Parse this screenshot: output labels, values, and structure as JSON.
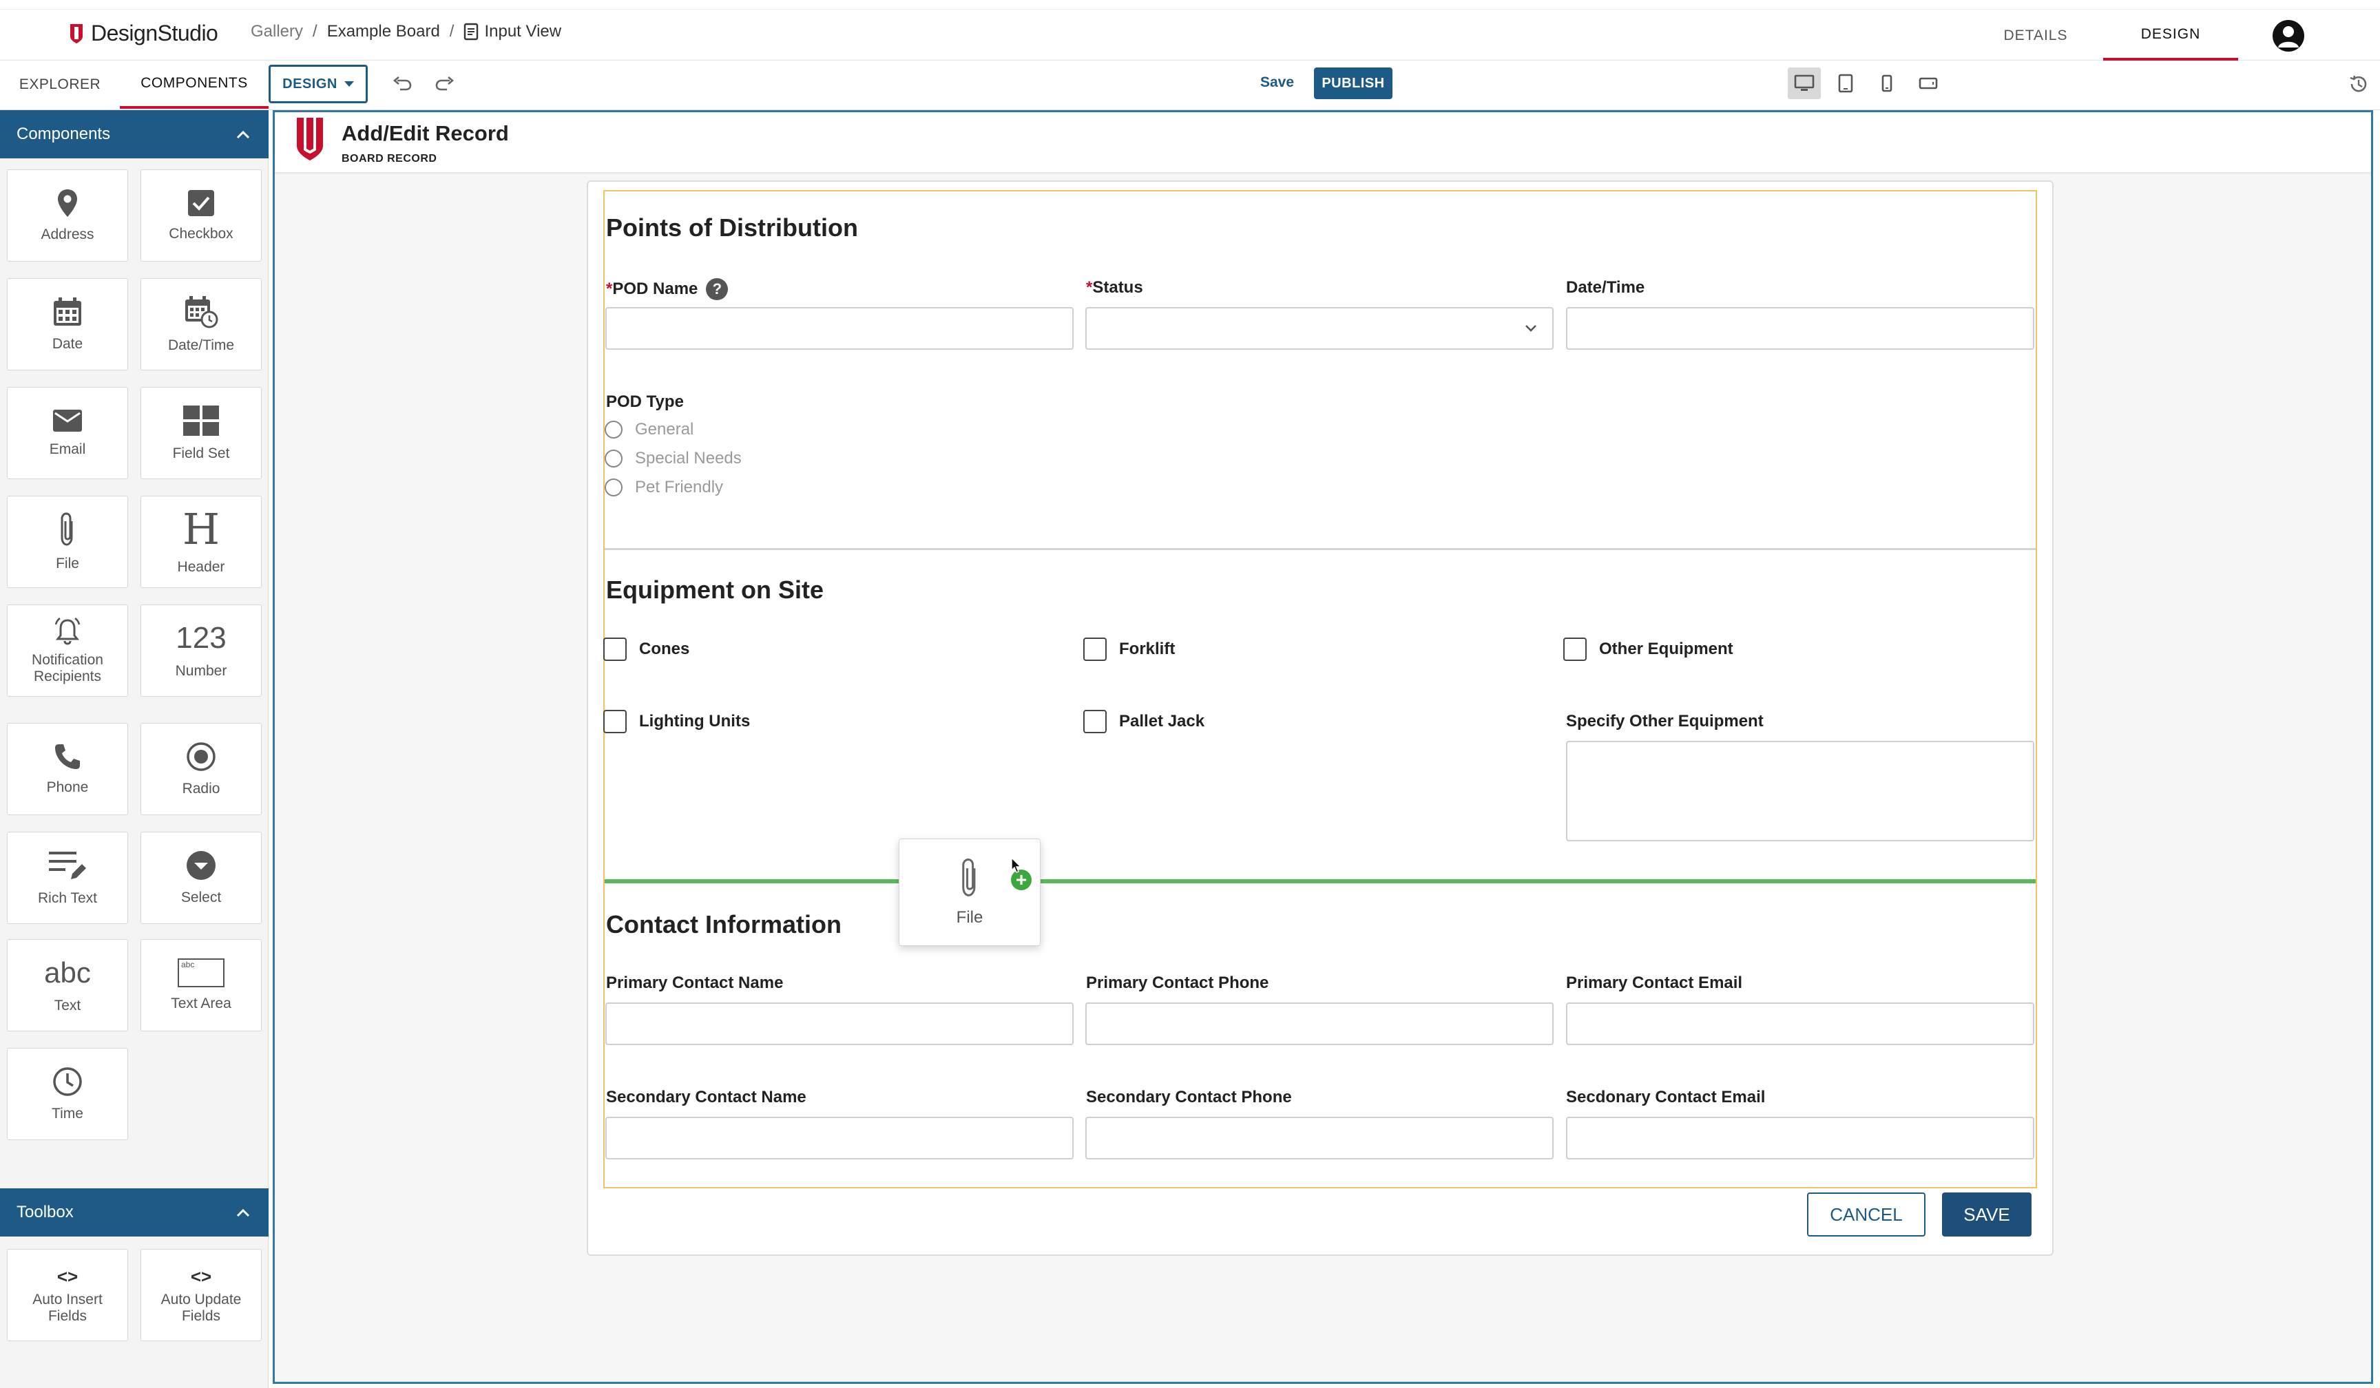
{
  "app": {
    "logo_text": "DesignStudio",
    "brand_color": "#c8102e",
    "accent_color": "#1d5a86"
  },
  "breadcrumb": {
    "items": [
      "Gallery",
      "Example Board",
      "Input View"
    ],
    "separator": "/"
  },
  "header_tabs": [
    "DETAILS",
    "DESIGN"
  ],
  "header_active_tab": "DESIGN",
  "left_tabs": [
    "EXPLORER",
    "COMPONENTS"
  ],
  "left_active_tab": "COMPONENTS",
  "toolbar": {
    "design_label": "DESIGN",
    "save_label": "Save",
    "publish_label": "PUBLISH",
    "device_active": "desktop"
  },
  "components_panel": {
    "title": "Components",
    "items": [
      {
        "label": "Address",
        "icon": "map-pin-icon"
      },
      {
        "label": "Checkbox",
        "icon": "checkbox-icon"
      },
      {
        "label": "Date",
        "icon": "calendar-icon"
      },
      {
        "label": "Date/Time",
        "icon": "calendar-clock-icon"
      },
      {
        "label": "Email",
        "icon": "envelope-icon"
      },
      {
        "label": "Field Set",
        "icon": "grid-icon"
      },
      {
        "label": "File",
        "icon": "paperclip-icon"
      },
      {
        "label": "Header",
        "icon": "header-h-icon",
        "glyph": "H"
      },
      {
        "label": "Notification Recipients",
        "icon": "bell-icon"
      },
      {
        "label": "Number",
        "icon": "number-icon",
        "glyph": "123"
      },
      {
        "label": "Phone",
        "icon": "phone-icon"
      },
      {
        "label": "Radio",
        "icon": "radio-icon"
      },
      {
        "label": "Rich Text",
        "icon": "rich-text-icon"
      },
      {
        "label": "Select",
        "icon": "select-icon"
      },
      {
        "label": "Text",
        "icon": "text-icon",
        "glyph": "abc"
      },
      {
        "label": "Text Area",
        "icon": "textarea-icon",
        "glyph": "abc"
      },
      {
        "label": "Time",
        "icon": "clock-icon"
      }
    ]
  },
  "toolbox_panel": {
    "title": "Toolbox",
    "items": [
      {
        "label": "Auto Insert Fields",
        "icon": "code-icon",
        "glyph": "<>"
      },
      {
        "label": "Auto Update Fields",
        "icon": "code-icon",
        "glyph": "<>"
      }
    ]
  },
  "record": {
    "title": "Add/Edit Record",
    "subtitle": "BOARD RECORD"
  },
  "form": {
    "section1": {
      "title": "Points of Distribution",
      "fields": [
        {
          "label": "POD Name",
          "required": true,
          "help": "?"
        },
        {
          "label": "Status",
          "required": true
        },
        {
          "label": "Date/Time",
          "required": false
        }
      ],
      "pod_type": {
        "label": "POD Type",
        "options": [
          "General",
          "Special Needs",
          "Pet Friendly"
        ]
      }
    },
    "section2": {
      "title": "Equipment on Site",
      "checkboxes": [
        "Cones",
        "Forklift",
        "Other Equipment",
        "Lighting Units",
        "Pallet Jack"
      ],
      "textarea_label": "Specify Other Equipment"
    },
    "section3": {
      "title": "Contact Information",
      "fields": [
        "Primary Contact Name",
        "Primary Contact Phone",
        "Primary Contact Email",
        "Secondary Contact Name",
        "Secondary Contact Phone",
        "Secdonary Contact Email"
      ]
    },
    "required_marker": "*",
    "cancel_label": "CANCEL",
    "save_label": "SAVE"
  },
  "drag_ghost": {
    "label": "File",
    "icon": "paperclip-icon",
    "badge": "+"
  }
}
